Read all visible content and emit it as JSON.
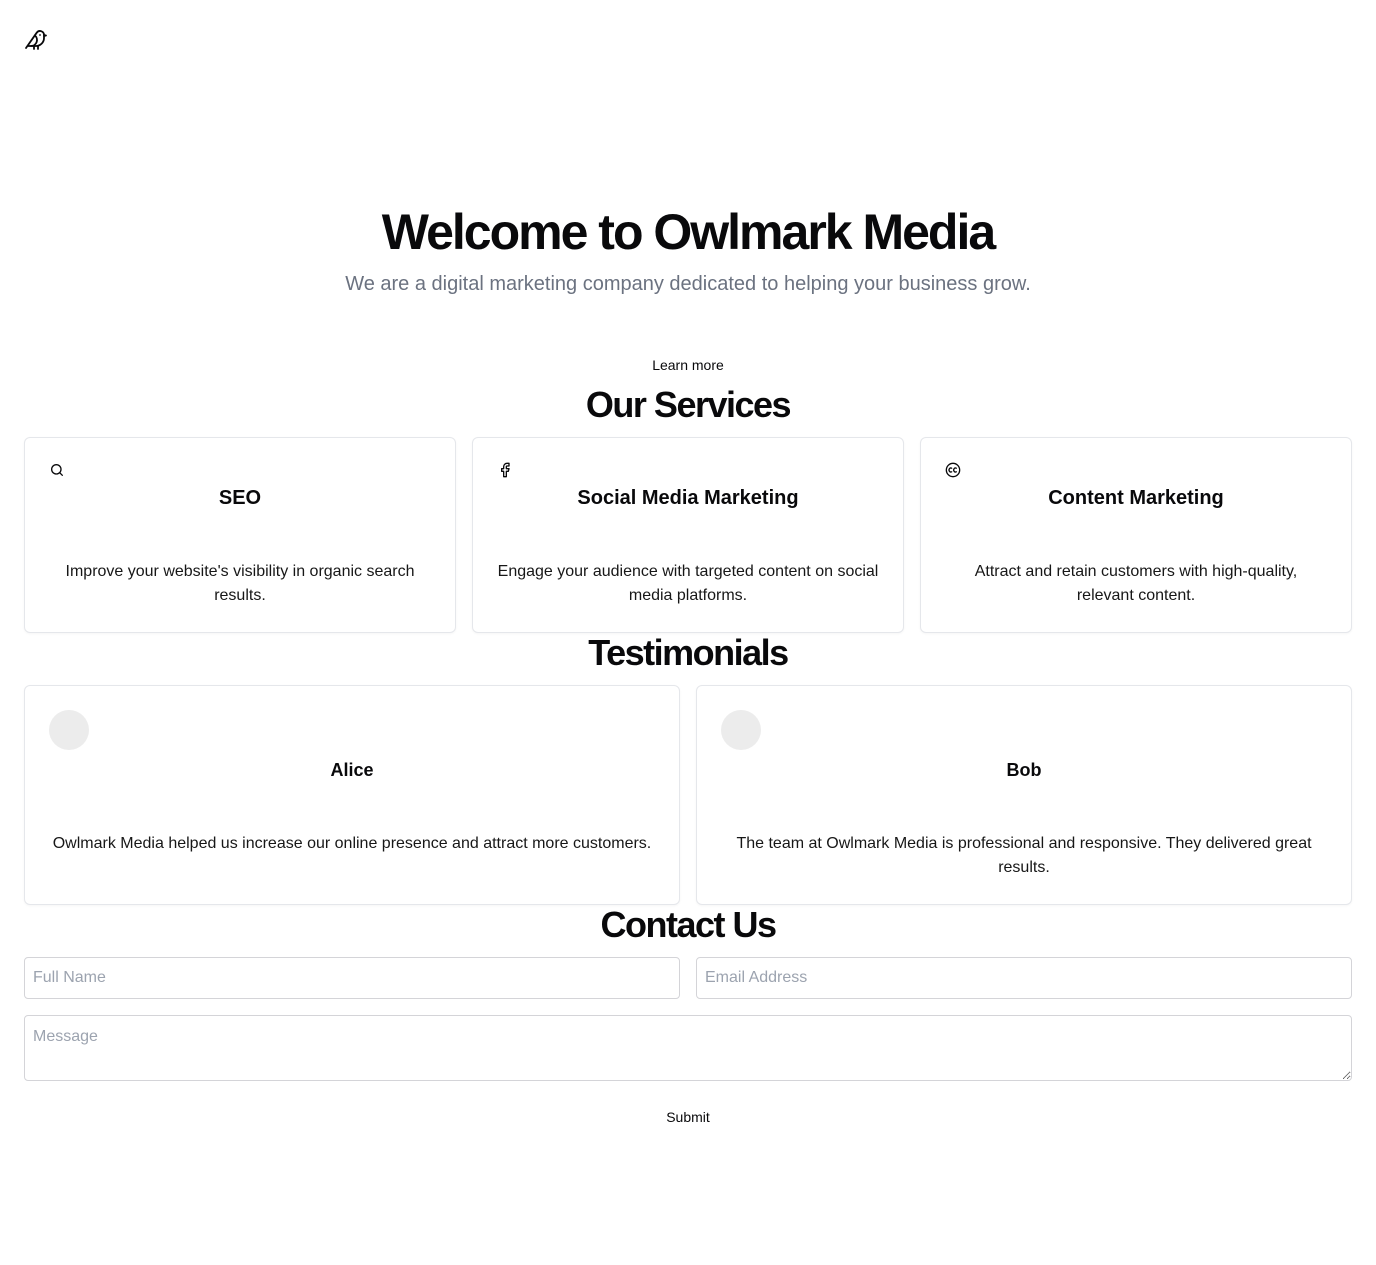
{
  "header": {
    "logo_icon": "bird-icon"
  },
  "hero": {
    "title": "Welcome to Owlmark Media",
    "subtitle": "We are a digital marketing company dedicated to helping your business grow.",
    "cta_label": "Learn more"
  },
  "services": {
    "title": "Our Services",
    "items": [
      {
        "icon": "search-icon",
        "title": "SEO",
        "description": "Improve your website's visibility in organic search results."
      },
      {
        "icon": "facebook-icon",
        "title": "Social Media Marketing",
        "description": "Engage your audience with targeted content on social media platforms."
      },
      {
        "icon": "creative-commons-icon",
        "title": "Content Marketing",
        "description": "Attract and retain customers with high-quality, relevant content."
      }
    ]
  },
  "testimonials": {
    "title": "Testimonials",
    "items": [
      {
        "name": "Alice",
        "quote": "Owlmark Media helped us increase our online presence and attract more customers."
      },
      {
        "name": "Bob",
        "quote": "The team at Owlmark Media is professional and responsive. They delivered great results."
      }
    ]
  },
  "contact": {
    "title": "Contact Us",
    "name_placeholder": "Full Name",
    "email_placeholder": "Email Address",
    "message_placeholder": "Message",
    "submit_label": "Submit"
  },
  "colors": {
    "text": "#09090b",
    "muted": "#6b7280",
    "border": "#e5e7eb",
    "placeholder": "#9ca3af",
    "avatar_bg": "#ececec"
  }
}
